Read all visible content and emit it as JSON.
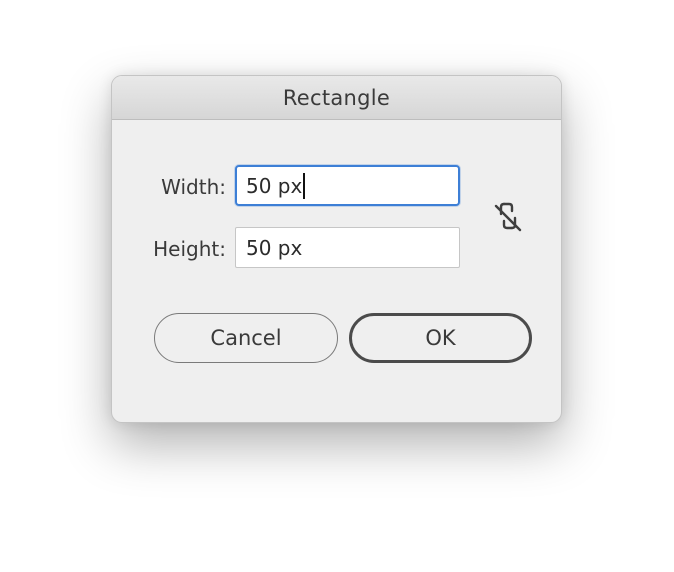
{
  "dialog": {
    "title": "Rectangle",
    "width_label": "Width:",
    "width_value": "50 px",
    "height_label": "Height:",
    "height_value": "50 px",
    "constrain_icon": "unlinked-chain-icon",
    "cancel_label": "Cancel",
    "ok_label": "OK"
  },
  "colors": {
    "focus_ring": "#3d7fd6",
    "dialog_bg": "#efefef"
  }
}
